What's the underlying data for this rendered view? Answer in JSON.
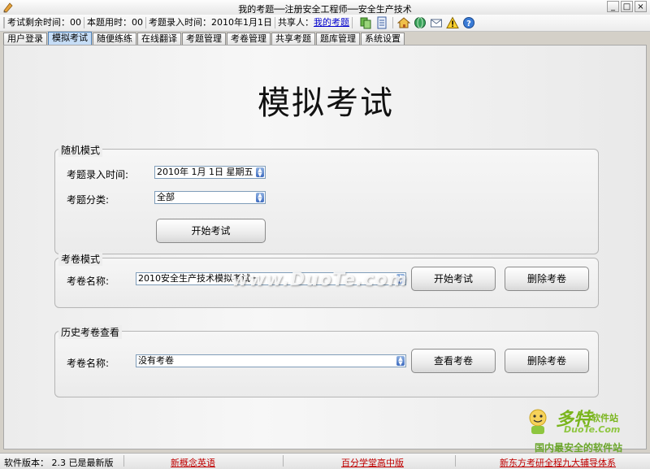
{
  "window": {
    "title": "我的考题──注册安全工程师──安全生产技术",
    "minimize": "_",
    "maximize": "□",
    "close": "×"
  },
  "info_bar": {
    "remaining_label": "考试剩余时间：",
    "remaining_value": "00",
    "used_label": "本题用时：",
    "used_value": "00",
    "entry_label": "考题录入时间：",
    "entry_value": "2010年1月1日",
    "sharer_label": "共享人：",
    "sharer_link": "我的考题",
    "icons": [
      "copy-icon",
      "document-icon",
      "home-icon",
      "globe-icon",
      "mail-icon",
      "warning-icon",
      "help-icon"
    ]
  },
  "tabs": [
    {
      "label": "用户登录",
      "active": false
    },
    {
      "label": "模拟考试",
      "active": true
    },
    {
      "label": "随便练练",
      "active": false
    },
    {
      "label": "在线翻译",
      "active": false
    },
    {
      "label": "考题管理",
      "active": false
    },
    {
      "label": "考卷管理",
      "active": false
    },
    {
      "label": "共享考题",
      "active": false
    },
    {
      "label": "题库管理",
      "active": false
    },
    {
      "label": "系统设置",
      "active": false
    }
  ],
  "main": {
    "title": "模拟考试",
    "random_mode": {
      "legend": "随机模式",
      "date_label": "考题录入时间:",
      "date_value": "2010年  1月  1日  星期五",
      "category_label": "考题分类:",
      "category_value": "全部",
      "start_button": "开始考试"
    },
    "paper_mode": {
      "legend": "考卷模式",
      "paper_label": "考卷名称:",
      "paper_value": "2010安全生产技术模拟考试一",
      "start_button": "开始考试",
      "delete_button": "删除考卷"
    },
    "history": {
      "legend": "历史考卷查看",
      "paper_label": "考卷名称:",
      "paper_value": "没有考卷",
      "view_button": "查看考卷",
      "delete_button": "删除考卷"
    }
  },
  "watermark": "www.DuoTe.com",
  "logo": {
    "main": "多特",
    "sub": "软件站",
    "url": "DuoTe.Com",
    "tagline": "国内最安全的软件站"
  },
  "footer": {
    "version_label": "软件版本：",
    "version_value": "2.3",
    "version_status": "已是最新版",
    "links": [
      "新概念英语",
      "百分学堂高中版",
      "新东方考研全程九大辅导体系"
    ]
  },
  "colors": {
    "accent_tab": "#c6ddf6",
    "link_blue": "#0000cc",
    "link_red": "#c00000",
    "spin_blue": "#3e6cc0"
  }
}
